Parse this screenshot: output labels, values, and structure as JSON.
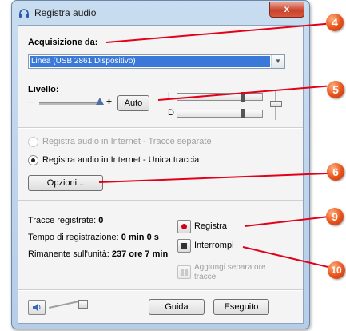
{
  "window": {
    "title": "Registra audio",
    "close_label": "x"
  },
  "acquisizione": {
    "label": "Acquisizione da:",
    "selected": "Linea (USB 2861 Dispositivo)"
  },
  "livello": {
    "label": "Livello:",
    "minus": "−",
    "plus": "+",
    "auto_button": "Auto",
    "meters": [
      {
        "channel": "L"
      },
      {
        "channel": "D"
      }
    ]
  },
  "options": {
    "radio_separate": "Registra audio in Internet - Tracce separate",
    "radio_single": "Registra audio in Internet - Unica traccia",
    "opzioni_button": "Opzioni..."
  },
  "stats": {
    "tracks_label": "Tracce registrate:",
    "tracks_value": "0",
    "time_label": "Tempo di registrazione:",
    "time_value": "0 min 0 s",
    "remaining_label": "Rimanente sull'unità:",
    "remaining_value": "237 ore 7 min"
  },
  "controls": {
    "registra": "Registra",
    "interrompi": "Interrompi",
    "separator_line1": "Aggiungi separatore",
    "separator_line2": "tracce"
  },
  "footer": {
    "guida": "Guida",
    "eseguito": "Eseguito"
  },
  "callouts": [
    "4",
    "5",
    "6",
    "9",
    "10"
  ],
  "colors": {
    "callout_badge": "#e8521b",
    "callout_line": "#e2001a",
    "selection": "#3b79d8",
    "record_dot": "#d0021b"
  }
}
